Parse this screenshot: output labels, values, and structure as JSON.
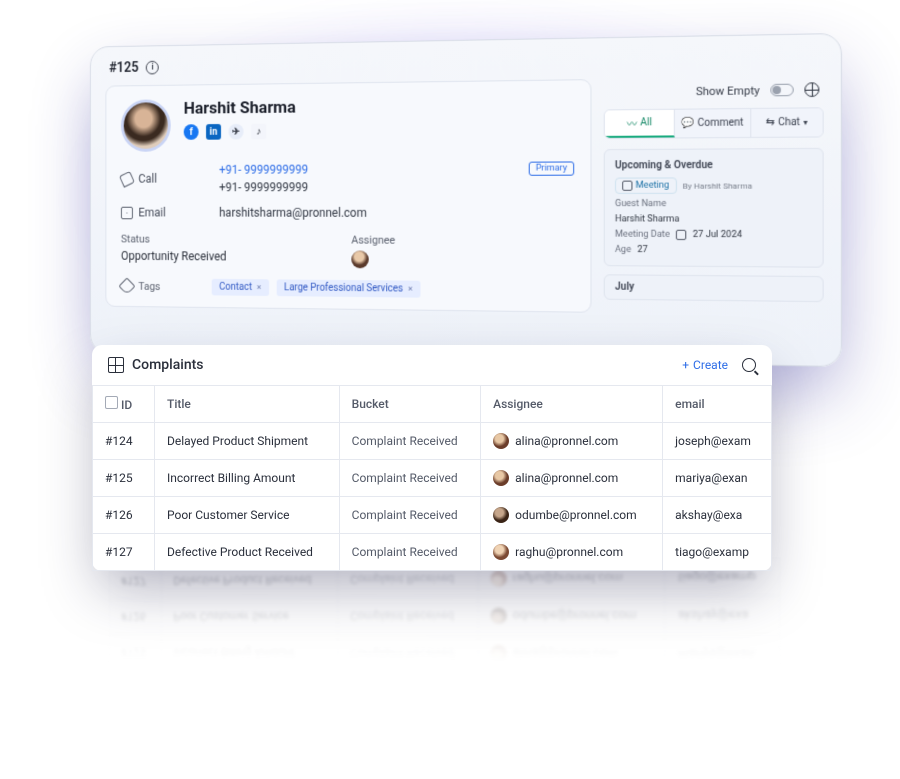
{
  "header": {
    "record_id": "#125"
  },
  "top": {
    "show_empty_label": "Show Empty"
  },
  "contact": {
    "name": "Harshit Sharma",
    "social": {
      "facebook": "facebook-icon",
      "linkedin": "linkedin-icon",
      "telegram": "telegram-icon",
      "tiktok": "tiktok-icon"
    },
    "call_label": "Call",
    "email_label": "Email",
    "phone_primary": "+91- 9999999999",
    "phone_secondary": "+91- 9999999999",
    "primary_badge": "Primary",
    "email_value": "harshitsharma@pronnel.com",
    "status_label": "Status",
    "status_value": "Opportunity Received",
    "assignee_label": "Assignee",
    "tags_label": "Tags",
    "tags": [
      "Contact",
      "Large Professional Services"
    ]
  },
  "activity": {
    "tabs": {
      "all": "All",
      "comment": "Comment",
      "chat": "Chat"
    },
    "upcoming_title": "Upcoming & Overdue",
    "meeting_label": "Meeting",
    "by_label": "By Harshit Sharma",
    "fields": {
      "guest_name_label": "Guest Name",
      "guest_name_value": "Harshit Sharma",
      "meeting_date_label": "Meeting Date",
      "meeting_date_value": "27 Jul 2024",
      "age_label": "Age",
      "age_value": "27"
    },
    "month": "July"
  },
  "complaints": {
    "title": "Complaints",
    "create_label": "Create",
    "columns": {
      "id": "ID",
      "title": "Title",
      "bucket": "Bucket",
      "assignee": "Assignee",
      "email": "email"
    },
    "rows": [
      {
        "id": "#124",
        "title": "Delayed Product Shipment",
        "bucket": "Complaint Received",
        "assignee": "alina@pronnel.com",
        "avatar": "a",
        "email": "joseph@exam"
      },
      {
        "id": "#125",
        "title": "Incorrect Billing Amount",
        "bucket": "Complaint Received",
        "assignee": "alina@pronnel.com",
        "avatar": "a",
        "email": "mariya@exan"
      },
      {
        "id": "#126",
        "title": "Poor Customer Service",
        "bucket": "Complaint Received",
        "assignee": "odumbe@pronnel.com",
        "avatar": "o",
        "email": "akshay@exa"
      },
      {
        "id": "#127",
        "title": "Defective Product Received",
        "bucket": "Complaint Received",
        "assignee": "raghu@pronnel.com",
        "avatar": "r",
        "email": "tiago@examp"
      }
    ]
  }
}
